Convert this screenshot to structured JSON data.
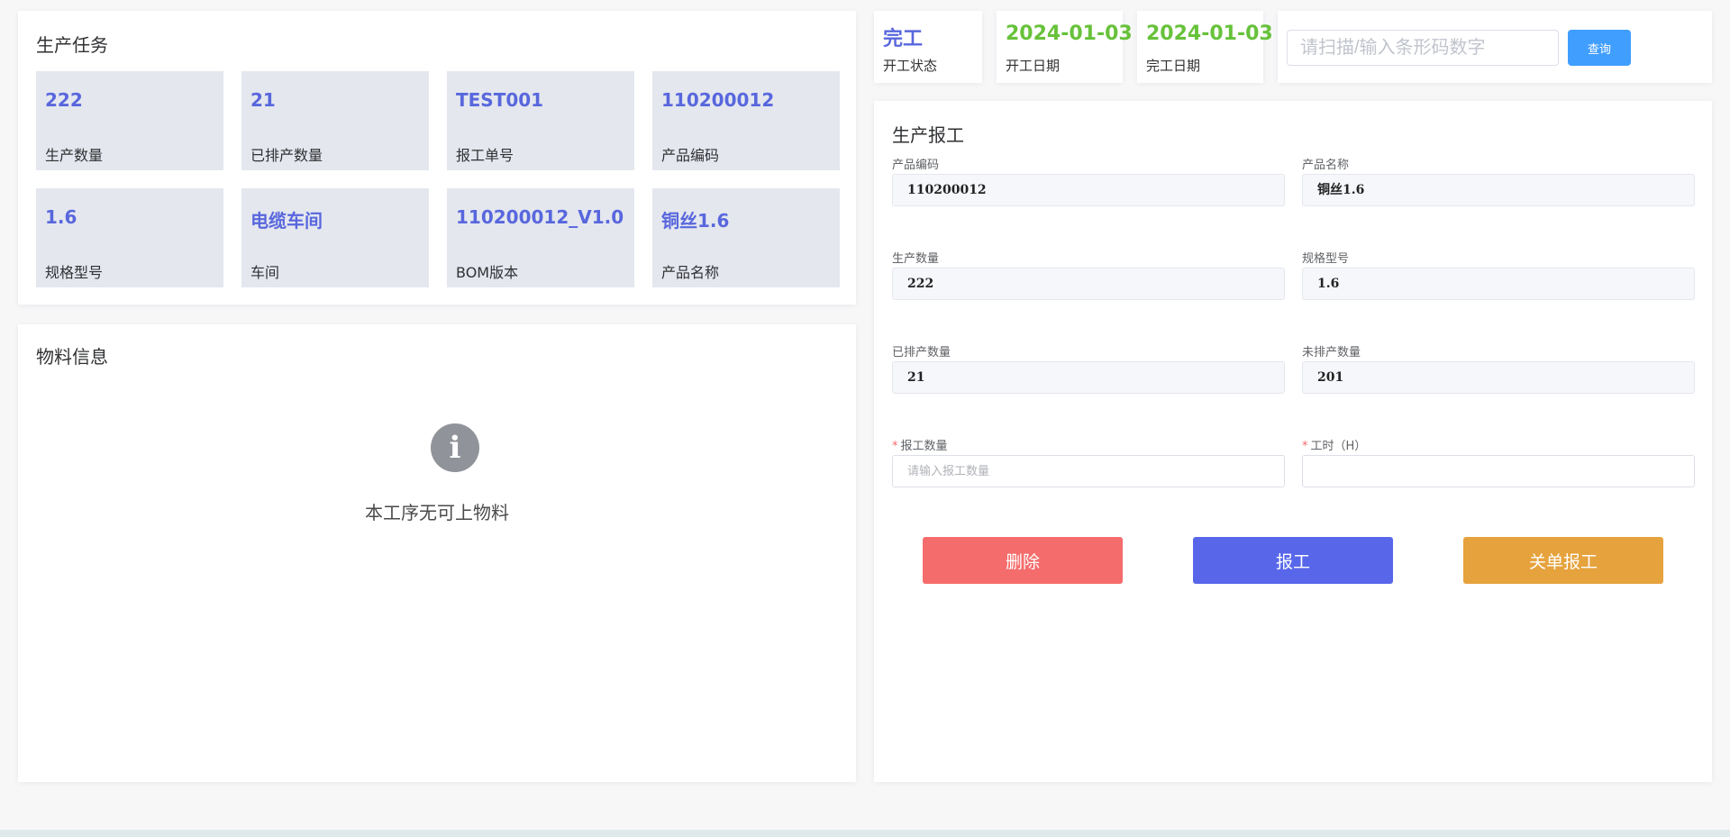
{
  "task": {
    "title": "生产任务",
    "cards": [
      {
        "value": "222",
        "label": "生产数量"
      },
      {
        "value": "21",
        "label": "已排产数量"
      },
      {
        "value": "TEST001",
        "label": "报工单号"
      },
      {
        "value": "110200012",
        "label": "产品编码"
      },
      {
        "value": "1.6",
        "label": "规格型号"
      },
      {
        "value": "电缆车间",
        "label": "车间"
      },
      {
        "value": "110200012_V1.0",
        "label": "BOM版本"
      },
      {
        "value": "铜丝1.6",
        "label": "产品名称"
      }
    ]
  },
  "material": {
    "title": "物料信息",
    "empty_text": "本工序无可上物料",
    "icon": "info-icon",
    "icon_glyph": "i"
  },
  "status": {
    "state_value": "完工",
    "state_label": "开工状态",
    "start_value": "2024-01-03",
    "start_label": "开工日期",
    "end_value": "2024-01-03",
    "end_label": "完工日期"
  },
  "search": {
    "placeholder": "请扫描/输入条形码数字",
    "query_label": "查询"
  },
  "report": {
    "title": "生产报工",
    "product_code_label": "产品编码",
    "product_code": "110200012",
    "product_name_label": "产品名称",
    "product_name": "铜丝1.6",
    "quantity_label": "生产数量",
    "quantity": "222",
    "spec_label": "规格型号",
    "spec": "1.6",
    "scheduled_label": "已排产数量",
    "scheduled": "21",
    "unscheduled_label": "未排产数量",
    "unscheduled": "201",
    "report_qty_label": "报工数量",
    "report_qty_placeholder": "请输入报工数量",
    "hours_label": "工时（H）",
    "required_mark": "*",
    "delete_label": "删除",
    "report_label": "报工",
    "close_report_label": "关单报工"
  },
  "colors": {
    "accent_blue": "#5867dd",
    "date_green": "#67c23a",
    "query_blue": "#409eff",
    "delete_red": "#f56c6c",
    "close_orange": "#e6a23c"
  }
}
